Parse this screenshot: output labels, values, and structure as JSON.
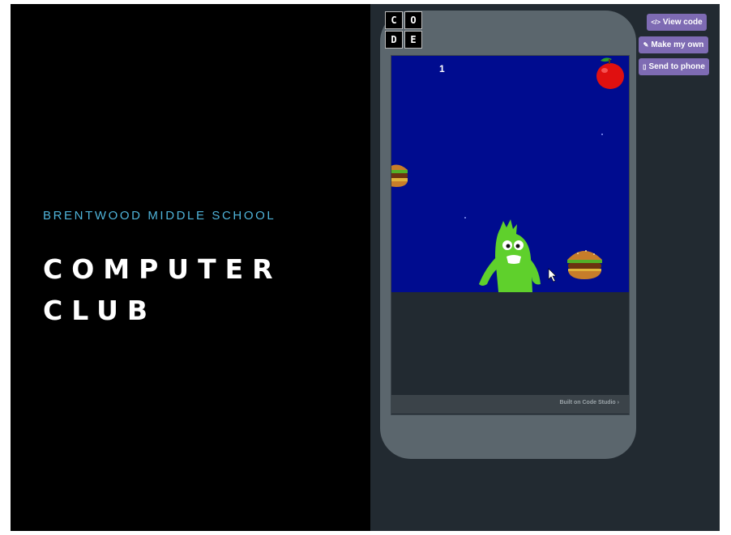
{
  "slide": {
    "subtitle": "BRENTWOOD MIDDLE SCHOOL",
    "title_line1": "COMPUTER",
    "title_line2": "CLUB"
  },
  "app": {
    "logo_letters": [
      "C",
      "O",
      "D",
      "E"
    ],
    "score": "1",
    "footer_text": "Built on Code Studio ›",
    "buttons": {
      "view_code": "View code",
      "make_my_own": "Make my own",
      "send_to_phone": "Send to phone"
    },
    "icons": {
      "view_code": "code-icon",
      "make_my_own": "edit-icon",
      "send_to_phone": "phone-icon"
    }
  },
  "colors": {
    "game_background": "#000c8f",
    "button": "#7e6bb3",
    "subtitle": "#4fb3d9",
    "character": "#5fd02c"
  }
}
